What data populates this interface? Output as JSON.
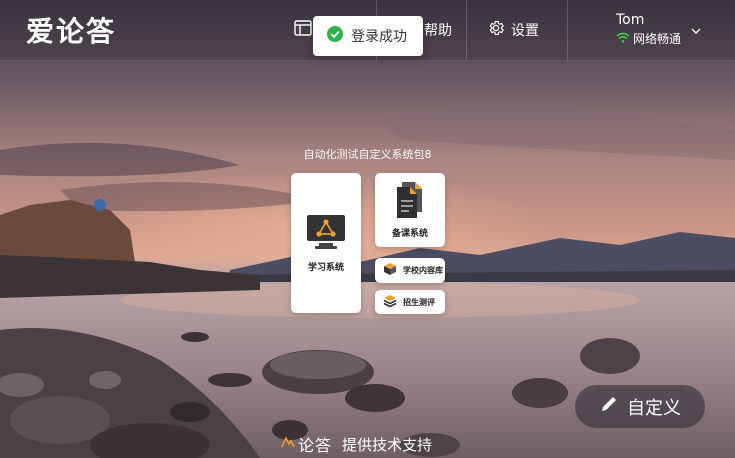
{
  "header": {
    "logo_text": "爱论答",
    "nav_help_label": "帮助",
    "nav_settings_label": "设置"
  },
  "user": {
    "name": "Tom",
    "network_status": "网络畅通"
  },
  "toast": {
    "message": "登录成功"
  },
  "package": {
    "title": "自动化测试自定义系统包8"
  },
  "tiles": {
    "learning": "学习系统",
    "lesson_prep": "备课系统",
    "school_content": "学校内容库",
    "admission_eval": "招生测评"
  },
  "custom_button": {
    "label": "自定义"
  },
  "footer": {
    "brand": "论答",
    "text": "提供技术支持"
  },
  "colors": {
    "success": "#2fb24a",
    "network_ok": "#39c64b",
    "accent_orange": "#f0a12b"
  }
}
